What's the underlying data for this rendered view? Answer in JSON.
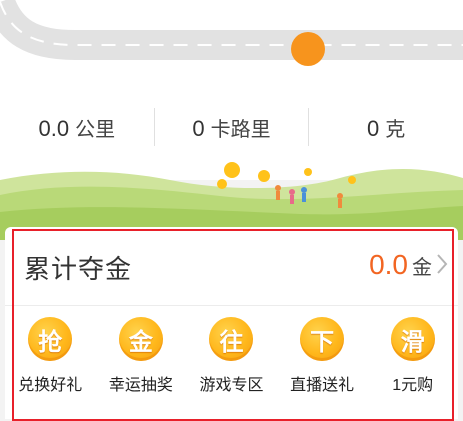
{
  "stats": [
    {
      "value": "0.0",
      "unit": "公里"
    },
    {
      "value": "0",
      "unit": "卡路里"
    },
    {
      "value": "0",
      "unit": "克"
    }
  ],
  "gold_card": {
    "title": "累计夺金",
    "amount": "0.0",
    "unit": "金"
  },
  "shortcuts": [
    {
      "glyph": "抢",
      "label": "兑换好礼",
      "icon": "exchange-gift-icon"
    },
    {
      "glyph": "金",
      "label": "幸运抽奖",
      "icon": "lucky-draw-icon"
    },
    {
      "glyph": "往",
      "label": "游戏专区",
      "icon": "game-zone-icon"
    },
    {
      "glyph": "下",
      "label": "直播送礼",
      "icon": "live-gift-icon"
    },
    {
      "glyph": "滑",
      "label": "1元购",
      "icon": "one-yuan-buy-icon"
    }
  ],
  "colors": {
    "accent": "#f26522",
    "progress_dot": "#f7941d",
    "coin": "#ffb71b",
    "highlight_frame": "#e8202a",
    "hill_green": "#b9d978",
    "road": "#e2e2e2"
  }
}
